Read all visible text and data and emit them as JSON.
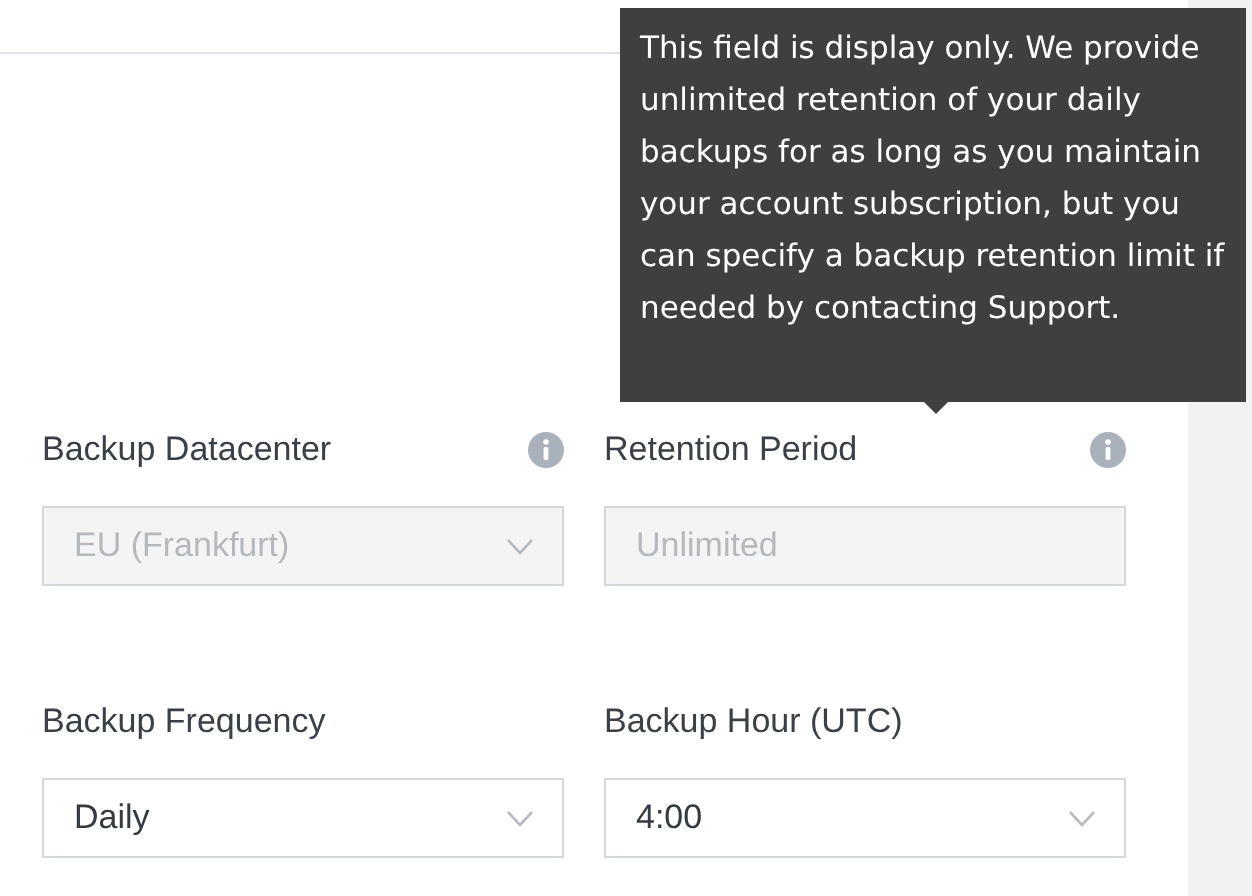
{
  "fields": [
    {
      "label": "Backup Datacenter",
      "kind": "select",
      "value": "EU (Frankfurt)",
      "disabled": true,
      "info": true
    },
    {
      "label": "Retention Period",
      "kind": "text",
      "value": "Unlimited",
      "disabled": true,
      "info": true
    },
    {
      "label": "Backup Frequency",
      "kind": "select",
      "value": "Daily",
      "disabled": false,
      "info": false
    },
    {
      "label": "Backup Hour (UTC)",
      "kind": "select",
      "value": "4:00",
      "disabled": false,
      "info": false
    }
  ],
  "tooltip": {
    "text": "This field is display only. We provide unlimited retention of your daily backups for as long as you maintain your account subscription, but you can specify a backup retention limit if needed by contacting Support."
  }
}
